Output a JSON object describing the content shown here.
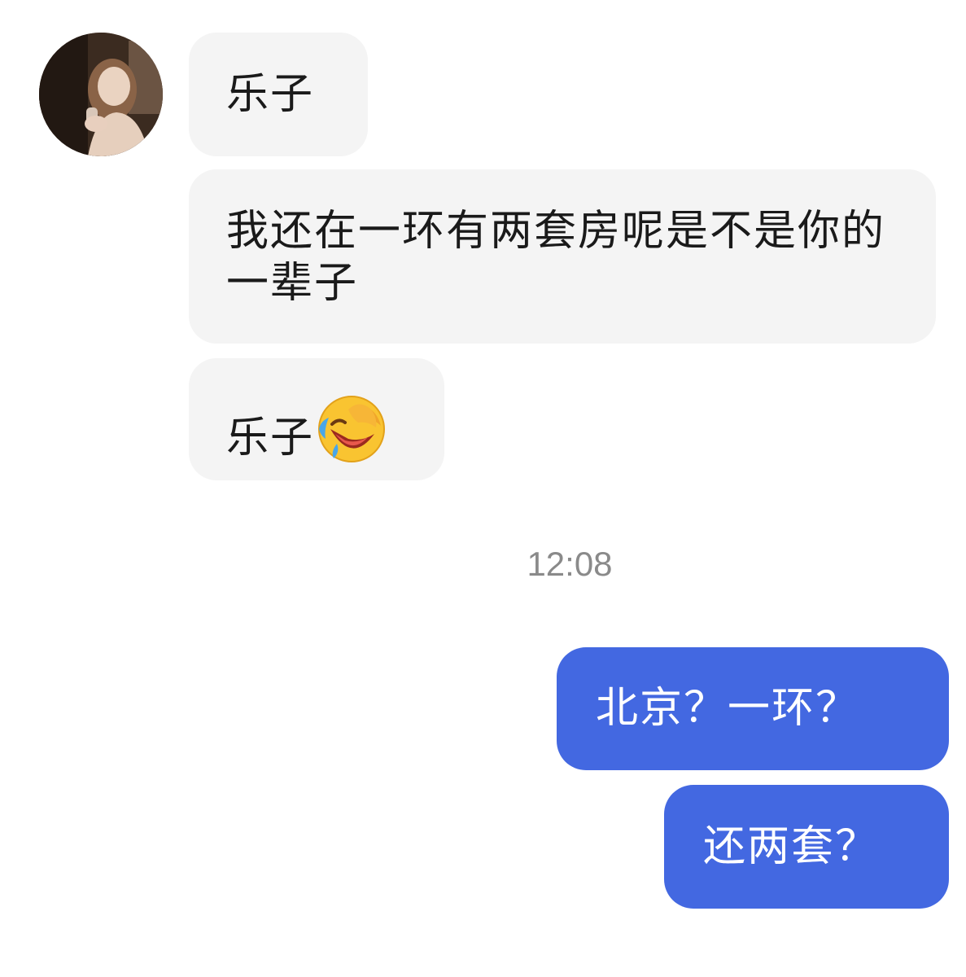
{
  "messages": [
    {
      "sender": "other",
      "text": "乐子"
    },
    {
      "sender": "other",
      "text": "我还在一环有两套房呢是不是你的一辈子"
    },
    {
      "sender": "other",
      "text": "乐子",
      "emoji": "laughing-tears-icon"
    },
    {
      "sender": "self",
      "text": "北京？一环？"
    },
    {
      "sender": "self",
      "text": "还两套？"
    }
  ],
  "timestamp": "12:08",
  "colors": {
    "incoming_bubble": "#f4f4f4",
    "outgoing_bubble": "#4368e1",
    "timestamp": "#8a8a8a"
  }
}
